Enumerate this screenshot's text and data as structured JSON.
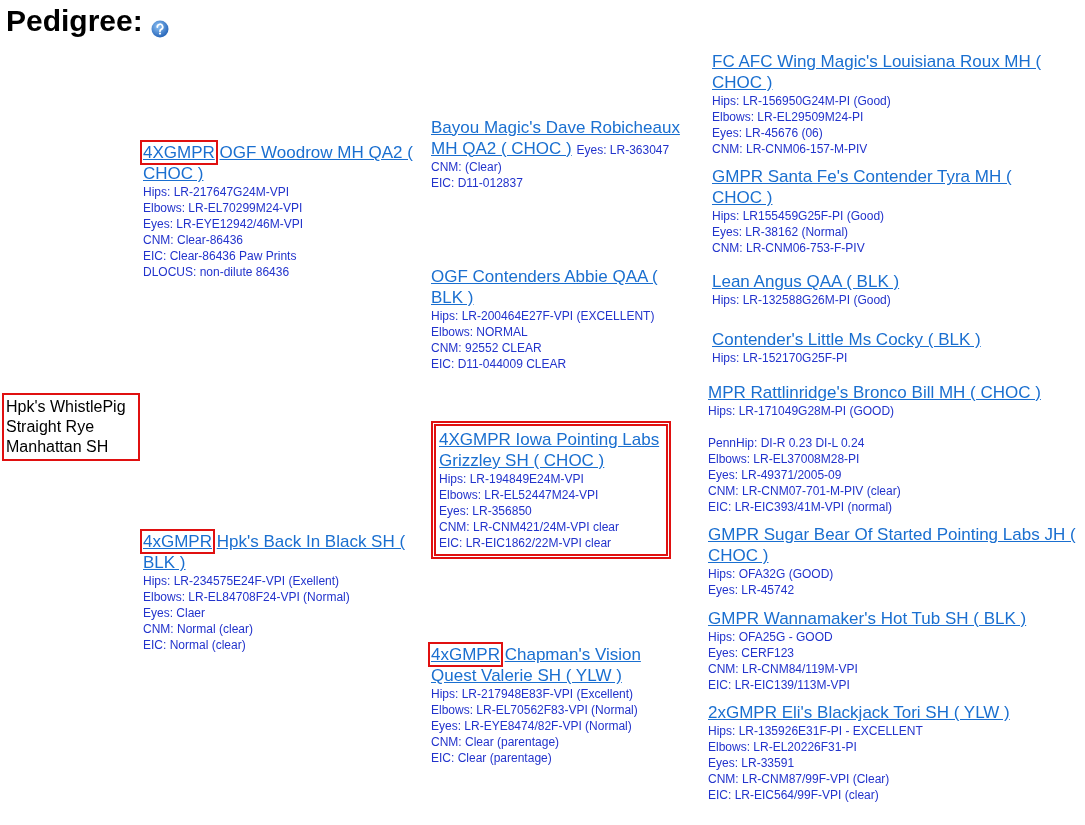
{
  "heading": "Pedigree:",
  "subject": {
    "name": "Hpk's WhistlePig Straight Rye Manhattan SH",
    "boxed": true,
    "parents": [
      {
        "prefix": "4XGMPR",
        "prefix_boxed": true,
        "name": "OGF Woodrow MH QA2 ( CHOC )",
        "framed": false,
        "notes": [
          "Hips: LR-217647G24M-VPI",
          "Elbows: LR-EL70299M24-VPI",
          "Eyes: LR-EYE12942/46M-VPI",
          "CNM: Clear-86436",
          "EIC: Clear-86436 Paw Prints",
          "DLOCUS: non-dilute 86436"
        ],
        "parents": [
          {
            "name": "Bayou Magic's Dave Robicheaux MH QA2 ( CHOC )",
            "framed": false,
            "inline_first_note": true,
            "notes": [
              "Eyes: LR-363047",
              "CNM: (Clear)",
              "EIC: D11-012837"
            ],
            "parents": [
              {
                "name": "FC AFC Wing Magic's Louisiana Roux MH ( CHOC )",
                "framed": false,
                "notes": [
                  "Hips: LR-156950G24M-PI (Good)",
                  "Elbows: LR-EL29509M24-PI",
                  "Eyes: LR-45676 (06)",
                  "CNM: LR-CNM06-157-M-PIV"
                ]
              },
              {
                "name": "GMPR Santa Fe's Contender Tyra MH ( CHOC )",
                "framed": false,
                "notes": [
                  "Hips: LR155459G25F-PI (Good)",
                  "Eyes: LR-38162 (Normal)",
                  "CNM: LR-CNM06-753-F-PIV"
                ]
              }
            ]
          },
          {
            "name": "OGF Contenders Abbie QAA ( BLK )",
            "framed": false,
            "notes": [
              "Hips: LR-200464E27F-VPI (EXCELLENT)",
              "Elbows: NORMAL",
              "CNM: 92552 CLEAR",
              "EIC: D11-044009 CLEAR"
            ],
            "parents": [
              {
                "name": "Lean Angus QAA ( BLK )",
                "framed": false,
                "notes": [
                  "Hips: LR-132588G26M-PI (Good)"
                ]
              },
              {
                "name": "Contender's Little Ms Cocky ( BLK )",
                "framed": false,
                "notes": [
                  "Hips: LR-152170G25F-PI"
                ]
              }
            ]
          }
        ]
      },
      {
        "prefix": "4xGMPR",
        "prefix_boxed": true,
        "name": "Hpk's Back In Black SH ( BLK )",
        "framed": false,
        "notes": [
          "Hips: LR-234575E24F-VPI (Exellent)",
          "Elbows: LR-EL84708F24-VPI (Normal)",
          "Eyes: Claer",
          "CNM: Normal (clear)",
          "EIC: Normal (clear)"
        ],
        "parents": [
          {
            "name": "4XGMPR Iowa Pointing Labs Grizzley SH ( CHOC )",
            "framed": true,
            "notes": [
              "Hips: LR-194849E24M-VPI",
              "Elbows: LR-EL52447M24-VPI",
              "Eyes: LR-356850",
              "CNM: LR-CNM421/24M-VPI clear",
              "EIC: LR-EIC1862/22M-VPI clear"
            ],
            "parents": [
              {
                "name": "MPR Rattlinridge's Bronco Bill MH ( CHOC )",
                "framed": false,
                "break_after_first": true,
                "notes": [
                  "Hips: LR-171049G28M-PI (GOOD)",
                  "PennHip: DI-R 0.23 DI-L 0.24",
                  "Elbows: LR-EL37008M28-PI",
                  "Eyes: LR-49371/2005-09",
                  "CNM: LR-CNM07-701-M-PIV (clear)",
                  "EIC: LR-EIC393/41M-VPI (normal)"
                ]
              },
              {
                "name": "GMPR Sugar Bear Of Started Pointing Labs JH ( CHOC )",
                "framed": false,
                "notes": [
                  "Hips: OFA32G (GOOD)",
                  "Eyes: LR-45742"
                ]
              }
            ]
          },
          {
            "prefix": "4xGMPR",
            "prefix_boxed": true,
            "name": "Chapman's Vision Quest Valerie SH ( YLW )",
            "framed": false,
            "notes": [
              "Hips: LR-217948E83F-VPI (Excellent)",
              "Elbows: LR-EL70562F83-VPI (Normal)",
              "Eyes: LR-EYE8474/82F-VPI (Normal)",
              "CNM: Clear (parentage)",
              "EIC: Clear (parentage)"
            ],
            "parents": [
              {
                "name": "GMPR Wannamaker's Hot Tub SH ( BLK )",
                "framed": false,
                "notes": [
                  "Hips: OFA25G - GOOD",
                  "Eyes: CERF123",
                  "CNM: LR-CNM84/119M-VPI",
                  "EIC: LR-EIC139/113M-VPI"
                ]
              },
              {
                "name": "2xGMPR Eli's Blackjack Tori SH ( YLW )",
                "framed": false,
                "notes": [
                  "Hips: LR-135926E31F-PI - EXCELLENT",
                  "Elbows: LR-EL20226F31-PI",
                  "Eyes: LR-33591",
                  "CNM: LR-CNM87/99F-VPI (Clear)",
                  "EIC: LR-EIC564/99F-VPI (clear)"
                ]
              }
            ]
          }
        ]
      }
    ]
  }
}
